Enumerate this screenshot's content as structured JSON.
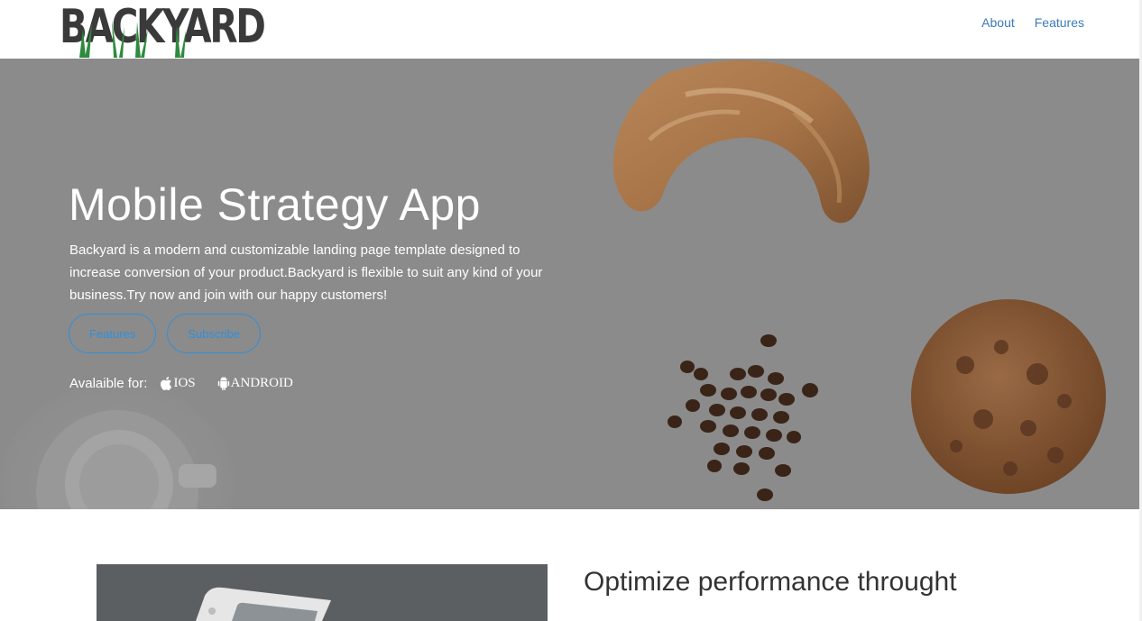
{
  "navbar": {
    "logo_text": "BACKYARD",
    "links": [
      {
        "label": "About"
      },
      {
        "label": "Features"
      }
    ]
  },
  "hero": {
    "title": "Mobile Strategy App",
    "description": "Backyard is a modern and customizable landing page template designed to increase conversion of your product.Backyard is flexible to suit any kind of your business.Try now and join with our happy customers!",
    "buttons": [
      {
        "label": "Features"
      },
      {
        "label": "Subscribe"
      }
    ],
    "available_label": "Avalaible for:",
    "platforms": [
      {
        "label": "IOS",
        "icon": "apple-icon"
      },
      {
        "label": "ANDROID",
        "icon": "android-icon"
      }
    ]
  },
  "feature": {
    "heading": "Optimize performance throught"
  },
  "colors": {
    "accent": "#2f8fdc",
    "nav_link": "#3b7bb8",
    "hero_overlay": "#8b8b8b"
  }
}
